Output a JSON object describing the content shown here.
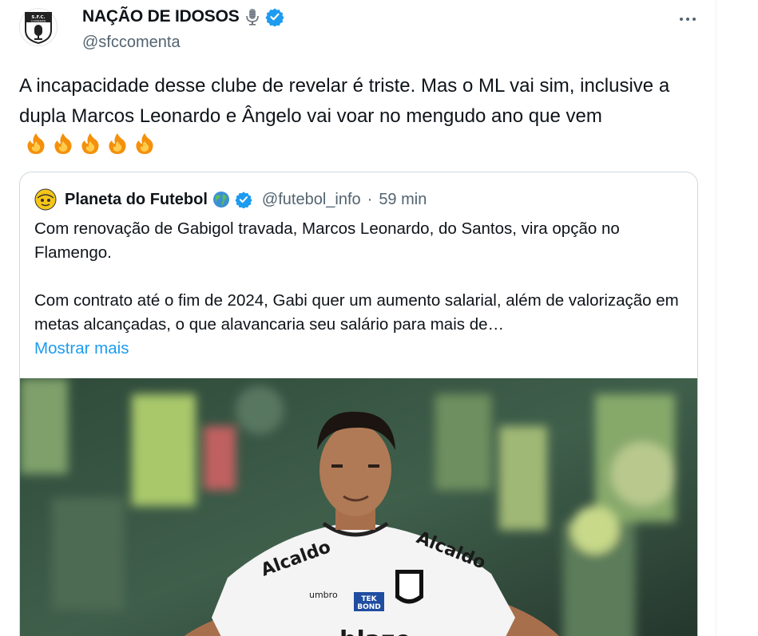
{
  "author": {
    "display_name": "NAÇÃO DE IDOSOS",
    "handle": "@sfccomenta",
    "avatar_text": "S.F.C. COMENTA",
    "verified_color": "#1d9bf0"
  },
  "tweet": {
    "text": "A incapacidade desse clube de revelar é triste. Mas o ML vai sim, inclusive a dupla Marcos Leonardo e Ângelo vai voar no mengudo ano que vem",
    "emoji_count": 5
  },
  "quote": {
    "display_name": "Planeta do Futebol",
    "handle": "@futebol_info",
    "separator": "·",
    "time": "59 min",
    "paragraph1": "Com renovação de Gabigol travada, Marcos Leonardo, do Santos, vira opção no Flamengo.",
    "paragraph2": "Com contrato até o fim de 2024, Gabi quer um aumento salarial, além de valorização em metas alcançadas, o que alavancaria seu salário para mais de…",
    "show_more": "Mostrar mais",
    "image": {
      "shirt_sponsor_1": "Alcaldo",
      "shirt_sponsor_2": "Alcaldo",
      "brand": "umbro",
      "sponsor_tek_1": "TEK",
      "sponsor_tek_2": "BOND",
      "front_sponsor": "blaze"
    }
  },
  "colors": {
    "accent": "#1d9bf0",
    "text": "#0f1419",
    "muted": "#536471",
    "border": "#cfd9de"
  }
}
